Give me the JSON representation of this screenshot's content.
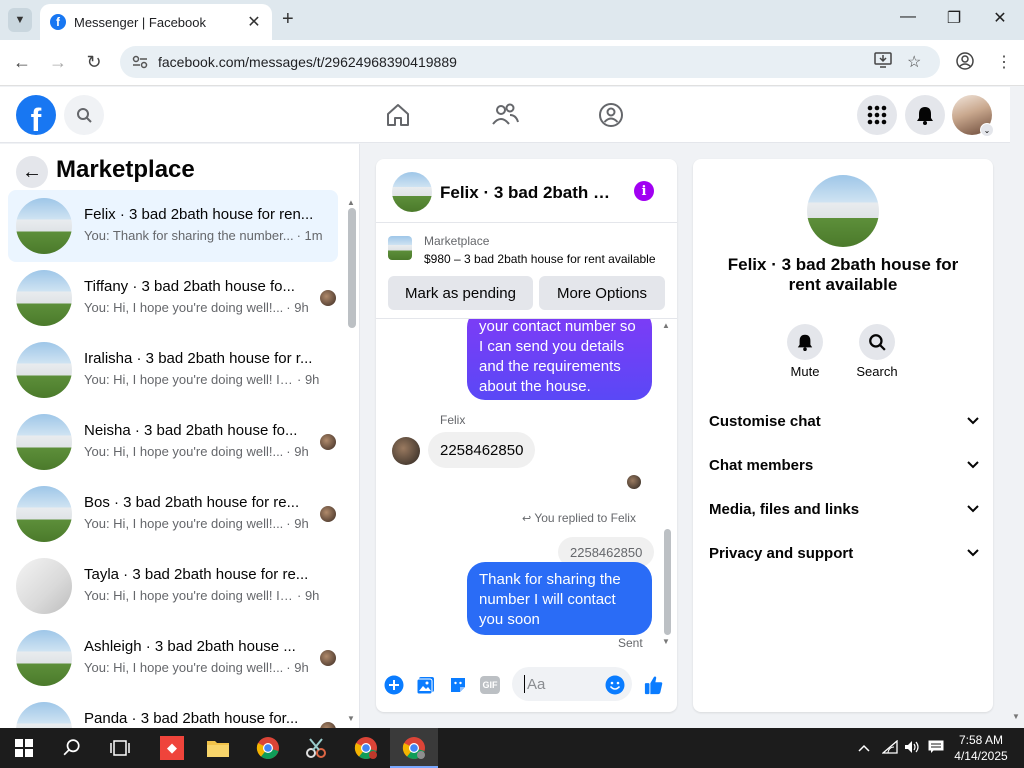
{
  "browser": {
    "tab_title": "Messenger | Facebook",
    "url": "facebook.com/messages/t/29624968390419889"
  },
  "facebook": {
    "logo_letter": "f"
  },
  "sidebar": {
    "title": "Marketplace",
    "conversations": [
      {
        "name": "Felix · 3 bad 2bath house for ren...",
        "preview": "You: Thank for sharing the number...",
        "time": "· 1m",
        "thumb": "house",
        "active": true,
        "seen": false
      },
      {
        "name": "Tiffany · 3 bad 2bath house fo...",
        "preview": "You: Hi, I hope you're doing well!...",
        "time": "· 9h",
        "thumb": "house",
        "active": false,
        "seen": true
      },
      {
        "name": "Iralisha · 3 bad 2bath house for r...",
        "preview": "You: Hi, I hope you're doing well! I j...",
        "time": "· 9h",
        "thumb": "house",
        "active": false,
        "seen": false
      },
      {
        "name": "Neisha · 3 bad 2bath house fo...",
        "preview": "You: Hi, I hope you're doing well!...",
        "time": "· 9h",
        "thumb": "house",
        "active": false,
        "seen": true
      },
      {
        "name": "Bos · 3 bad 2bath house for re...",
        "preview": "You: Hi, I hope you're doing well!...",
        "time": "· 9h",
        "thumb": "house",
        "active": false,
        "seen": true
      },
      {
        "name": "Tayla · 3 bad 2bath house for re...",
        "preview": "You: Hi, I hope you're doing well! I j...",
        "time": "· 9h",
        "thumb": "room",
        "active": false,
        "seen": false
      },
      {
        "name": "Ashleigh · 3 bad 2bath house ...",
        "preview": "You: Hi, I hope you're doing well!...",
        "time": "· 9h",
        "thumb": "house",
        "active": false,
        "seen": true
      },
      {
        "name": "Panda · 3 bad 2bath house for...",
        "preview": "",
        "time": "",
        "thumb": "house",
        "active": false,
        "seen": true
      }
    ]
  },
  "chat": {
    "title": "Felix · 3 bad 2bath house for rent available",
    "marketplace_label": "Marketplace",
    "listing": "$980 – 3 bad 2bath house for rent available",
    "mark_pending": "Mark as pending",
    "more_options": "More Options",
    "outgoing_1": "your contact number so I can send you details and the requirements about the house.",
    "sender": "Felix",
    "incoming_1": "2258462850",
    "replied_label": "You replied to Felix",
    "replied_preview": "2258462850",
    "outgoing_2": "Thank for sharing  the number I will contact you soon",
    "sent_status": "Sent",
    "input_placeholder": "Aa",
    "gif_label": "GIF"
  },
  "details": {
    "name": "Felix · 3 bad 2bath house for rent available",
    "mute_label": "Mute",
    "search_label": "Search",
    "sections": [
      "Customise chat",
      "Chat members",
      "Media, files and links",
      "Privacy and support"
    ]
  },
  "taskbar": {
    "time": "7:58 AM",
    "date": "4/14/2025"
  },
  "colors": {
    "fb_blue": "#1877f2",
    "messenger_purple": "#8a3ffc",
    "outgoing_blue": "#2a6cf6",
    "info_purple": "#a100f2"
  }
}
